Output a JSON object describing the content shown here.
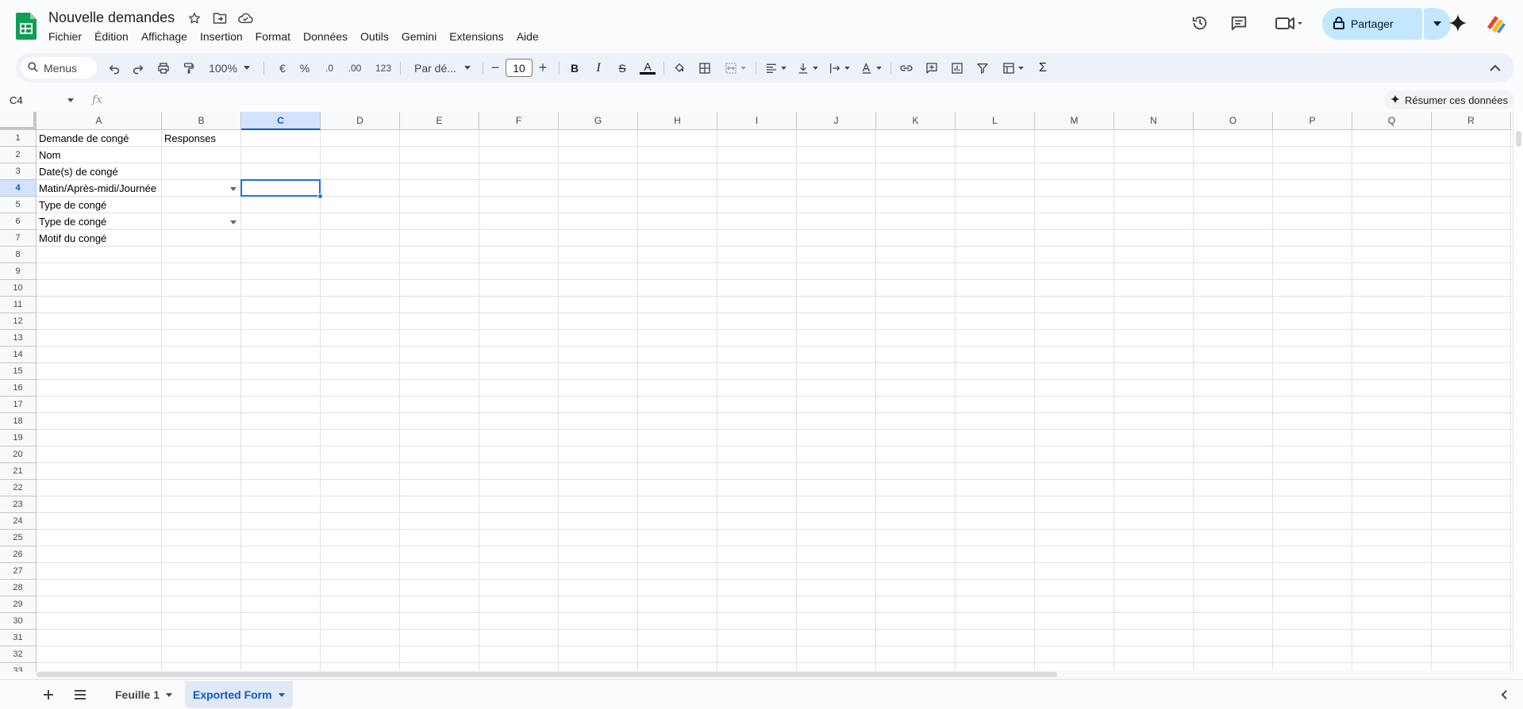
{
  "app": {
    "brand_color": "#0f9d58",
    "doc_title": "Nouvelle demandes",
    "menu": [
      "Fichier",
      "Édition",
      "Affichage",
      "Insertion",
      "Format",
      "Données",
      "Outils",
      "Gemini",
      "Extensions",
      "Aide"
    ],
    "share_label": "Partager",
    "icons": [
      "star-icon",
      "move-to-folder-icon",
      "cloud-status-icon",
      "version-history-icon",
      "comments-icon",
      "meet-icon",
      "gemini-sparkle-icon",
      "account-avatar-icon"
    ]
  },
  "toolbar": {
    "search_label": "Menus",
    "zoom": "100%",
    "currency": "€",
    "percent": "%",
    "decrease_decimals": ".0",
    "increase_decimals": ".00",
    "number_format": "123",
    "font_family": "Par dé...",
    "font_size": "10",
    "minus": "−",
    "plus": "+",
    "bold": "B",
    "italic": "I",
    "strike": "S",
    "text_color": "A",
    "sum": "Σ"
  },
  "formula_bar": {
    "cell_ref": "C4",
    "fx": "fx",
    "formula": "",
    "summarize_label": "Résumer ces données"
  },
  "grid": {
    "columns": [
      "A",
      "B",
      "C",
      "D",
      "E",
      "F",
      "G",
      "H",
      "I",
      "J",
      "K",
      "L",
      "M",
      "N",
      "O",
      "P",
      "Q",
      "R"
    ],
    "selected_column": "C",
    "rows": [
      "1",
      "2",
      "3",
      "4",
      "5",
      "6",
      "7",
      "8",
      "9",
      "10",
      "11",
      "12",
      "13",
      "14",
      "15",
      "16",
      "17",
      "18",
      "19",
      "20",
      "21",
      "22",
      "23",
      "24",
      "25",
      "26",
      "27",
      "28",
      "29",
      "30",
      "31",
      "32",
      "33"
    ],
    "selected_row": "4",
    "cells": {
      "A1": "Demande de congé",
      "B1": "Responses",
      "A2": "Nom",
      "A3": "Date(s) de congé",
      "A4": "Matin/Après-midi/Journée",
      "A5": "Type de congé",
      "A6": "Type de congé",
      "A7": "Motif du congé"
    },
    "dropdown_cells": [
      "B4",
      "B6"
    ],
    "active_cell": "C4",
    "selection_color": "#1a73e8"
  },
  "sheets": {
    "tabs": [
      {
        "label": "Feuille 1",
        "active": false
      },
      {
        "label": "Exported Form",
        "active": true
      }
    ]
  }
}
